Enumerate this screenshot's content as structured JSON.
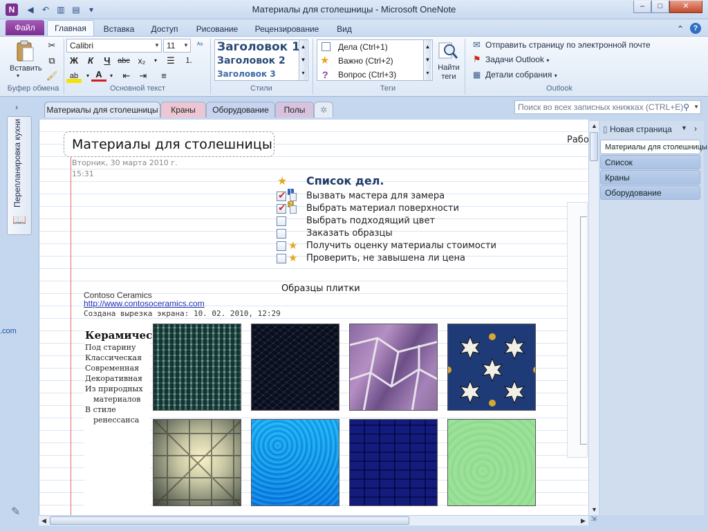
{
  "window": {
    "title": "Материалы для столешницы  -  Microsoft OneNote",
    "app_icon_letter": "N",
    "controls": {
      "minimize": "–",
      "maximize": "□",
      "close": "✕"
    }
  },
  "ribbon_tabs": [
    "Файл",
    "Главная",
    "Вставка",
    "Доступ",
    "Рисование",
    "Рецензирование",
    "Вид"
  ],
  "ribbon": {
    "clipboard": {
      "paste_label": "Вставить",
      "group_label": "Буфер обмена"
    },
    "basic_text": {
      "font": "Calibri",
      "size": "11",
      "group_label": "Основной текст",
      "format_glyphs": [
        "Ж",
        "К",
        "Ч",
        "abc",
        "x₂",
        "A"
      ]
    },
    "styles": {
      "items": [
        "Заголовок 1",
        "Заголовок 2",
        "Заголовок 3"
      ],
      "group_label": "Стили"
    },
    "tags": {
      "items": [
        "Дела (Ctrl+1)",
        "Важно (Ctrl+2)",
        "Вопрос (Ctrl+3)"
      ],
      "find_label_1": "Найти",
      "find_label_2": "теги",
      "group_label": "Теги"
    },
    "outlook": {
      "items": [
        "Отправить страницу по электронной почте",
        "Задачи Outlook",
        "Детали собрания"
      ],
      "group_label": "Outlook"
    }
  },
  "section_tabs": [
    {
      "label": "Материалы для столешницы",
      "color": "#dde7f6"
    },
    {
      "label": "Краны",
      "color": "#ecc7d3"
    },
    {
      "label": "Оборудование",
      "color": "#c7d3ef"
    },
    {
      "label": "Полы",
      "color": "#d7c3de"
    }
  ],
  "new_section_glyph": "✲",
  "search": {
    "placeholder": "Поиск во всех записных книжках (CTRL+E)"
  },
  "notebook": {
    "name": "Перепланировка кухни"
  },
  "page": {
    "title": "Материалы для столешницы",
    "date": "Вторник, 30 марта 2010 г.",
    "time": "15:31",
    "right_text": "Рабо",
    "todo_title": "Список дел.",
    "todos": [
      {
        "text": "Вызвать мастера для замера",
        "checked": true,
        "badge": "1",
        "star": false
      },
      {
        "text": "Выбрать материал поверхности",
        "checked": true,
        "badge": "2",
        "star": false
      },
      {
        "text": "Выбрать подходящий цвет",
        "checked": false,
        "badge": "",
        "star": false
      },
      {
        "text": "Заказать образцы",
        "checked": false,
        "badge": "",
        "star": false
      },
      {
        "text": "Получить оценку  материалы стоимости",
        "checked": false,
        "badge": "",
        "star": true
      },
      {
        "text": "Проверить, не завышена ли цена",
        "checked": false,
        "badge": "",
        "star": true
      }
    ],
    "samples_heading": "Образцы плитки",
    "clip_source": "Contoso Ceramics",
    "clip_url": "http://www.contosoceramics.com",
    "clip_created": "Создана вырезка экрана: 10. 02. 2010, 12:29",
    "left_stray": ".com",
    "ceramic_title": "Керамичес",
    "ceramic_links": [
      "Под старину",
      "Классическая",
      "Современная",
      "Декоративная",
      "Из природных",
      "материалов",
      "В стиле",
      "ренессанса"
    ]
  },
  "page_list": {
    "new_page": "Новая страница",
    "pages": [
      "Материалы для столешницы",
      "Список",
      "Краны",
      "Оборудование"
    ]
  }
}
